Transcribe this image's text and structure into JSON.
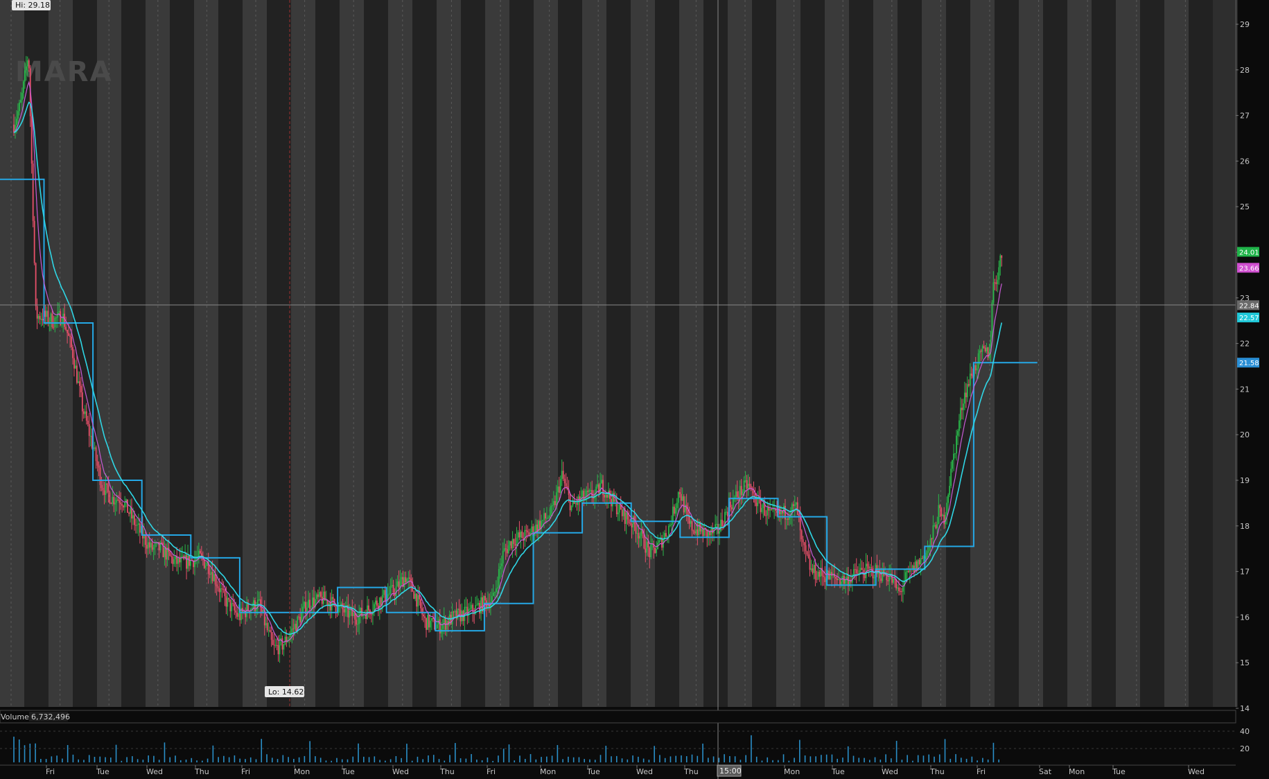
{
  "symbol": "MARA",
  "hi_label": "Hi: 29.18",
  "lo_label": "Lo: 14.62",
  "volume_label": "Volume",
  "volume_value": "6,732,496",
  "cursor_time": "15:00",
  "colors": {
    "background": "#0b0b0b",
    "band_light": "#3a3a3a",
    "band_dark": "#222222",
    "candle_up": "#29b84a",
    "candle_down": "#e8506a",
    "ma_cyan": "#2fd7e6",
    "ma_magenta": "#c85bd6",
    "step_blue": "#25a8e6",
    "volume": "#2a8fc8",
    "axis_text": "#c8c8c8",
    "grid_line": "#9a9a9a"
  },
  "price_axis": {
    "ticks": [
      "14",
      "15",
      "16",
      "17",
      "18",
      "19",
      "20",
      "21",
      "22",
      "23",
      "24",
      "25",
      "26",
      "27",
      "28",
      "29"
    ],
    "badges": [
      {
        "value": "24.01",
        "color": "#20b44a"
      },
      {
        "value": "23.66",
        "color": "#d04fd0"
      },
      {
        "value": "22.84",
        "color": "#6a6a6a"
      },
      {
        "value": "22.57",
        "color": "#20c8d8"
      },
      {
        "value": "21.58",
        "color": "#2a8fd6"
      }
    ]
  },
  "volume_axis": {
    "ticks": [
      "40",
      "20"
    ]
  },
  "time_axis": {
    "labels": [
      "Fri",
      "Tue",
      "Wed",
      "Thu",
      "Fri",
      "Mon",
      "Tue",
      "Wed",
      "Thu",
      "Fri",
      "Mon",
      "Tue",
      "Wed",
      "Thu",
      "Fri",
      "Mon",
      "Tue",
      "Wed",
      "Thu",
      "Fri",
      "Sat",
      "Mon",
      "Tue",
      "Wed"
    ]
  },
  "chart_data": {
    "type": "candlestick",
    "title": "MARA",
    "ylim": [
      14,
      29.4
    ],
    "crosshair_price": 22.84,
    "ema_fast_last": 23.66,
    "ema_slow_last": 22.57,
    "step_line_last": 21.58,
    "last_price": 24.01,
    "high": 29.18,
    "low": 14.62,
    "price_path": [
      {
        "d": 0.0,
        "p": 26.8
      },
      {
        "d": 0.15,
        "p": 27.3
      },
      {
        "d": 0.3,
        "p": 28.4
      },
      {
        "d": 0.45,
        "p": 22.6
      },
      {
        "d": 0.6,
        "p": 22.6
      },
      {
        "d": 0.8,
        "p": 22.5
      },
      {
        "d": 1.0,
        "p": 22.6
      },
      {
        "d": 1.2,
        "p": 21.8
      },
      {
        "d": 1.4,
        "p": 20.6
      },
      {
        "d": 1.6,
        "p": 19.8
      },
      {
        "d": 1.8,
        "p": 18.9
      },
      {
        "d": 2.0,
        "p": 18.6
      },
      {
        "d": 2.2,
        "p": 18.6
      },
      {
        "d": 2.5,
        "p": 18.0
      },
      {
        "d": 2.8,
        "p": 17.5
      },
      {
        "d": 3.0,
        "p": 17.5
      },
      {
        "d": 3.3,
        "p": 17.2
      },
      {
        "d": 3.5,
        "p": 17.2
      },
      {
        "d": 3.8,
        "p": 17.3
      },
      {
        "d": 4.0,
        "p": 17.1
      },
      {
        "d": 4.3,
        "p": 16.4
      },
      {
        "d": 4.6,
        "p": 16.0
      },
      {
        "d": 4.8,
        "p": 16.2
      },
      {
        "d": 5.0,
        "p": 16.3
      },
      {
        "d": 5.3,
        "p": 15.3
      },
      {
        "d": 5.5,
        "p": 15.4
      },
      {
        "d": 5.8,
        "p": 15.9
      },
      {
        "d": 6.0,
        "p": 16.3
      },
      {
        "d": 6.3,
        "p": 16.4
      },
      {
        "d": 6.5,
        "p": 16.3
      },
      {
        "d": 6.8,
        "p": 16.1
      },
      {
        "d": 7.0,
        "p": 16.0
      },
      {
        "d": 7.3,
        "p": 16.2
      },
      {
        "d": 7.5,
        "p": 16.4
      },
      {
        "d": 7.8,
        "p": 16.6
      },
      {
        "d": 8.0,
        "p": 16.9
      },
      {
        "d": 8.2,
        "p": 16.5
      },
      {
        "d": 8.4,
        "p": 15.9
      },
      {
        "d": 8.7,
        "p": 15.8
      },
      {
        "d": 9.0,
        "p": 16.0
      },
      {
        "d": 9.3,
        "p": 16.1
      },
      {
        "d": 9.6,
        "p": 16.3
      },
      {
        "d": 9.8,
        "p": 16.4
      },
      {
        "d": 10.0,
        "p": 17.4
      },
      {
        "d": 10.2,
        "p": 17.7
      },
      {
        "d": 10.5,
        "p": 17.8
      },
      {
        "d": 10.8,
        "p": 18.1
      },
      {
        "d": 11.0,
        "p": 18.3
      },
      {
        "d": 11.2,
        "p": 19.1
      },
      {
        "d": 11.4,
        "p": 18.4
      },
      {
        "d": 11.6,
        "p": 18.6
      },
      {
        "d": 11.9,
        "p": 18.7
      },
      {
        "d": 12.0,
        "p": 18.9
      },
      {
        "d": 12.2,
        "p": 18.6
      },
      {
        "d": 12.4,
        "p": 18.3
      },
      {
        "d": 12.7,
        "p": 18.0
      },
      {
        "d": 13.0,
        "p": 17.4
      },
      {
        "d": 13.2,
        "p": 17.6
      },
      {
        "d": 13.4,
        "p": 18.0
      },
      {
        "d": 13.6,
        "p": 18.8
      },
      {
        "d": 13.8,
        "p": 18.0
      },
      {
        "d": 14.0,
        "p": 17.9
      },
      {
        "d": 14.2,
        "p": 17.8
      },
      {
        "d": 14.4,
        "p": 17.9
      },
      {
        "d": 14.6,
        "p": 18.4
      },
      {
        "d": 14.8,
        "p": 18.7
      },
      {
        "d": 15.0,
        "p": 18.9
      },
      {
        "d": 15.2,
        "p": 18.5
      },
      {
        "d": 15.5,
        "p": 18.2
      },
      {
        "d": 15.8,
        "p": 18.3
      },
      {
        "d": 16.0,
        "p": 18.4
      },
      {
        "d": 16.1,
        "p": 17.6
      },
      {
        "d": 16.3,
        "p": 17.0
      },
      {
        "d": 16.6,
        "p": 16.9
      },
      {
        "d": 17.0,
        "p": 16.8
      },
      {
        "d": 17.3,
        "p": 17.0
      },
      {
        "d": 17.6,
        "p": 17.0
      },
      {
        "d": 17.9,
        "p": 16.9
      },
      {
        "d": 18.1,
        "p": 16.5
      },
      {
        "d": 18.2,
        "p": 16.8
      },
      {
        "d": 18.5,
        "p": 17.2
      },
      {
        "d": 18.7,
        "p": 17.5
      },
      {
        "d": 18.9,
        "p": 18.3
      },
      {
        "d": 19.0,
        "p": 18.1
      },
      {
        "d": 19.2,
        "p": 19.5
      },
      {
        "d": 19.4,
        "p": 20.8
      },
      {
        "d": 19.6,
        "p": 21.4
      },
      {
        "d": 19.8,
        "p": 21.8
      },
      {
        "d": 19.95,
        "p": 21.8
      },
      {
        "d": 20.0,
        "p": 23.2
      },
      {
        "d": 20.1,
        "p": 23.5
      },
      {
        "d": 20.2,
        "p": 24.0
      }
    ],
    "step_line": [
      {
        "from": 0.0,
        "to": 0.9,
        "p": 25.6
      },
      {
        "from": 0.9,
        "to": 1.9,
        "p": 22.45
      },
      {
        "from": 1.9,
        "to": 2.9,
        "p": 19.0
      },
      {
        "from": 2.9,
        "to": 3.9,
        "p": 17.8
      },
      {
        "from": 3.9,
        "to": 4.9,
        "p": 17.3
      },
      {
        "from": 4.9,
        "to": 6.9,
        "p": 16.1
      },
      {
        "from": 6.9,
        "to": 7.9,
        "p": 16.65
      },
      {
        "from": 7.9,
        "to": 8.9,
        "p": 16.1
      },
      {
        "from": 8.9,
        "to": 9.9,
        "p": 15.7
      },
      {
        "from": 9.9,
        "to": 10.9,
        "p": 16.3
      },
      {
        "from": 10.9,
        "to": 11.9,
        "p": 17.85
      },
      {
        "from": 11.9,
        "to": 12.9,
        "p": 18.5
      },
      {
        "from": 12.9,
        "to": 13.9,
        "p": 18.1
      },
      {
        "from": 13.9,
        "to": 14.9,
        "p": 17.75
      },
      {
        "from": 14.9,
        "to": 15.9,
        "p": 18.6
      },
      {
        "from": 15.9,
        "to": 16.9,
        "p": 18.2
      },
      {
        "from": 16.9,
        "to": 17.9,
        "p": 16.7
      },
      {
        "from": 17.9,
        "to": 18.9,
        "p": 17.05
      },
      {
        "from": 18.9,
        "to": 19.9,
        "p": 17.55
      },
      {
        "from": 19.9,
        "to": 21.2,
        "p": 21.58
      }
    ]
  }
}
